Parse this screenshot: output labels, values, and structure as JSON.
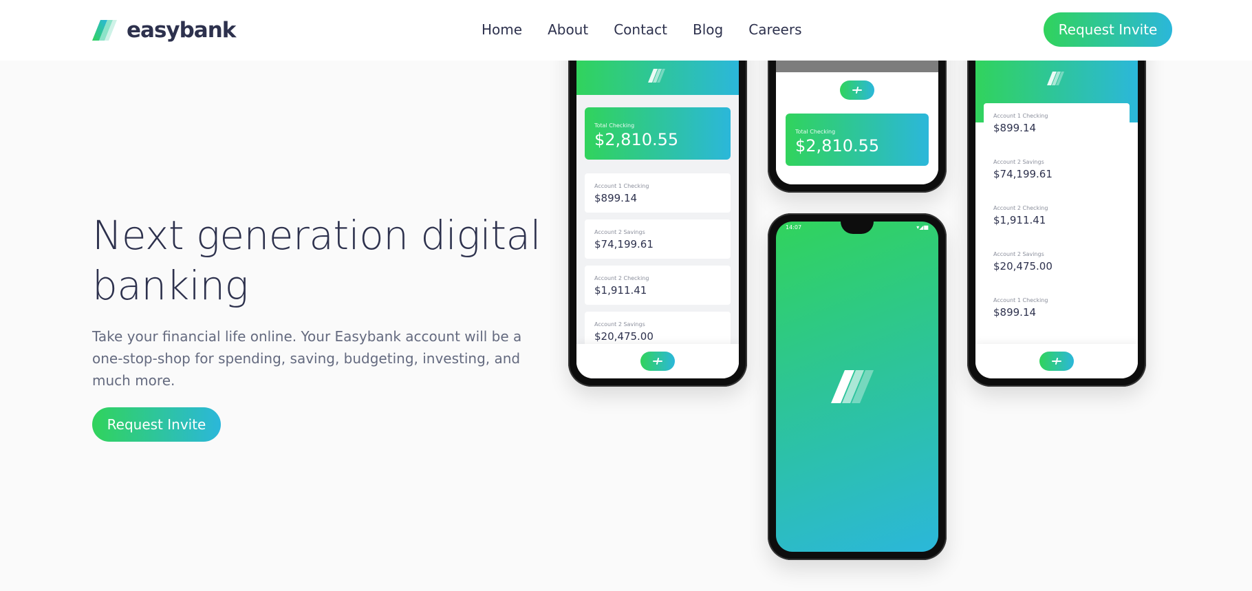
{
  "brand": {
    "name": "easybank",
    "colors": {
      "dark_blue": "#2d314d",
      "green": "#31d35c",
      "cyan": "#2bb7da",
      "grayish_blue": "#646a7f",
      "bg": "#fafafa"
    }
  },
  "nav": {
    "items": [
      "Home",
      "About",
      "Contact",
      "Blog",
      "Careers"
    ]
  },
  "header": {
    "cta_label": "Request Invite"
  },
  "hero": {
    "title": "Next generation digital banking",
    "text": "Take your financial life online. Your Easybank account will be a one-stop-shop for spending, saving, budgeting, investing, and much more.",
    "cta_label": "Request Invite"
  },
  "phones": {
    "total_label": "Total Checking",
    "total_amount": "$2,810.55",
    "left_accounts": [
      {
        "label": "Account 1 Checking",
        "amount": "$899.14"
      },
      {
        "label": "Account 2 Savings",
        "amount": "$74,199.61"
      },
      {
        "label": "Account 2 Checking",
        "amount": "$1,911.41"
      },
      {
        "label": "Account 2 Savings",
        "amount": "$20,475.00"
      }
    ],
    "right_accounts": [
      {
        "label": "Account 1 Checking",
        "amount": "$899.14"
      },
      {
        "label": "Account 2 Savings",
        "amount": "$74,199.61"
      },
      {
        "label": "Account 2 Checking",
        "amount": "$1,911.41"
      },
      {
        "label": "Account 2 Savings",
        "amount": "$20,475.00"
      },
      {
        "label": "Account 1 Checking",
        "amount": "$899.14"
      }
    ],
    "status_time": "14:07"
  }
}
